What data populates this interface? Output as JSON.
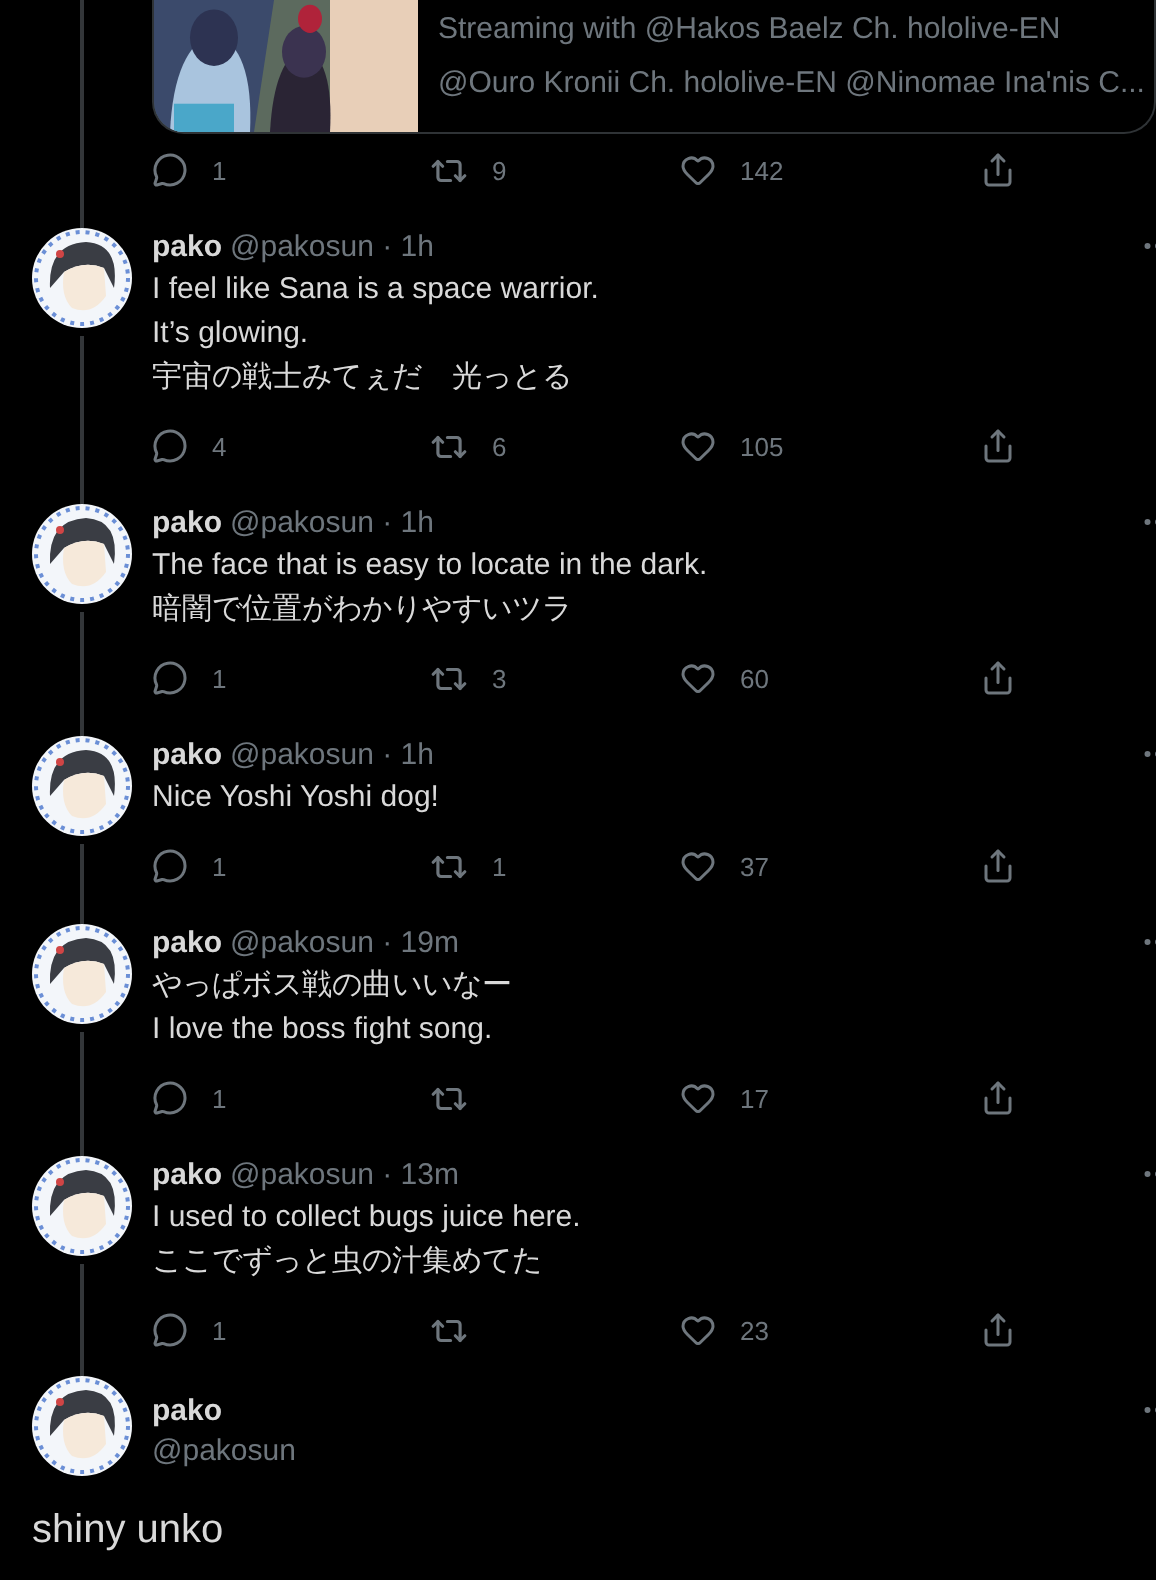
{
  "quoted_card": {
    "lines": [
      "Streaming with @Hakos Baelz Ch. hololive-EN",
      "@Ouro Kronii Ch. hololive-EN @Ninomae Ina'nis C..."
    ],
    "picture": {
      "kind": "picture"
    }
  },
  "top_actions": {
    "replies": "1",
    "retweets": "9",
    "likes": "142"
  },
  "tweets": [
    {
      "name": "pako",
      "meta": "@pakosun · 1h",
      "lines": [
        "I feel like Sana is a space warrior.",
        "It’s glowing.",
        "宇宙の戦士みてぇだ　光っとる"
      ],
      "actions": {
        "replies": "4",
        "retweets": "6",
        "likes": "105"
      }
    },
    {
      "name": "pako",
      "meta": "@pakosun · 1h",
      "lines": [
        "The face that is easy to locate in the dark.",
        "暗闇で位置がわかりやすいツラ"
      ],
      "actions": {
        "replies": "1",
        "retweets": "3",
        "likes": "60"
      }
    },
    {
      "name": "pako",
      "meta": "@pakosun · 1h",
      "lines": [
        "Nice Yoshi Yoshi dog!"
      ],
      "actions": {
        "replies": "1",
        "retweets": "1",
        "likes": "37"
      }
    },
    {
      "name": "pako",
      "meta": "@pakosun · 19m",
      "lines": [
        "やっぱボス戦の曲いいなー",
        "I love the boss fight song."
      ],
      "actions": {
        "replies": "1",
        "likes": "17"
      }
    },
    {
      "name": "pako",
      "meta": "@pakosun · 13m",
      "lines": [
        "I used to collect bugs juice here.",
        "ここでずっと虫の汁集めてた"
      ],
      "actions": {
        "replies": "1",
        "likes": "23"
      }
    }
  ],
  "main_tweet": {
    "name": "pako",
    "handle": "@pakosun",
    "text": "shiny unko"
  }
}
